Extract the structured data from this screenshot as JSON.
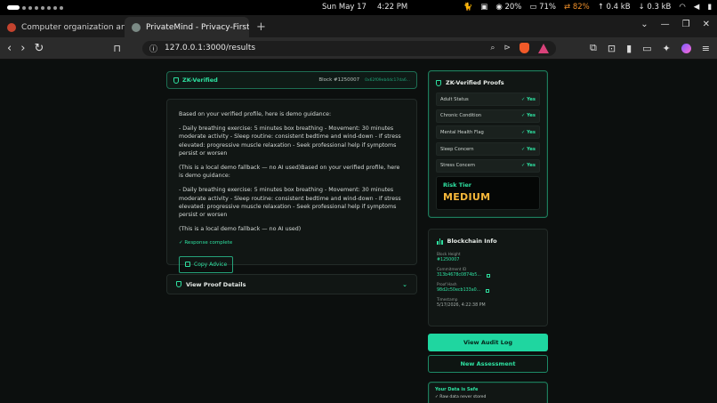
{
  "system_bar": {
    "date": "Sun May 17",
    "time": "4:22 PM",
    "cpu": "20%",
    "battery": "71%",
    "charge": "82%",
    "upload": "0.4 kB",
    "download": "0.3 kB"
  },
  "tabs": [
    {
      "title": "Computer organization and a",
      "active": false
    },
    {
      "title": "PrivateMind - Privacy-First",
      "active": true
    }
  ],
  "address_bar": {
    "url": "127.0.0.1:3000/results"
  },
  "zk_status": {
    "label": "ZK-Verified",
    "block": "Block #1250007",
    "hash": "0x62f09eb4dc17da6..."
  },
  "response": {
    "paragraphs": [
      "Based on your verified profile, here is demo guidance:",
      "- Daily breathing exercise: 5 minutes box breathing - Movement: 30 minutes moderate activity - Sleep routine: consistent bedtime and wind-down - If stress elevated: progressive muscle relaxation - Seek professional help if symptoms persist or worsen",
      "(This is a local demo fallback — no AI used)Based on your verified profile, here is demo guidance:",
      "- Daily breathing exercise: 5 minutes box breathing - Movement: 30 minutes moderate activity - Sleep routine: consistent bedtime and wind-down - If stress elevated: progressive muscle relaxation - Seek professional help if symptoms persist or worsen",
      "(This is a local demo fallback — no AI used)"
    ],
    "status": "Response complete",
    "copy_label": "Copy Advice"
  },
  "proof_details": {
    "label": "View Proof Details"
  },
  "zk_proofs": {
    "title": "ZK-Verified Proofs",
    "items": [
      {
        "label": "Adult Status",
        "value": "Yes"
      },
      {
        "label": "Chronic Condition",
        "value": "Yes"
      },
      {
        "label": "Mental Health Flag",
        "value": "Yes"
      },
      {
        "label": "Sleep Concern",
        "value": "Yes"
      },
      {
        "label": "Stress Concern",
        "value": "Yes"
      }
    ],
    "risk_label": "Risk Tier",
    "risk_value": "MEDIUM"
  },
  "blockchain": {
    "title": "Blockchain Info",
    "block_height_label": "Block Height",
    "block_height": "#1250007",
    "commitment_label": "Commitment ID",
    "commitment": "313b4678c0874b5...",
    "proof_hash_label": "Proof Hash",
    "proof_hash": "98d2c50ecb133a0...",
    "timestamp_label": "Timestamp",
    "timestamp": "5/17/2026, 4:22:38 PM"
  },
  "actions": {
    "audit": "View Audit Log",
    "new": "New Assessment"
  },
  "safety": {
    "title": "Your Data is Safe",
    "item1": "✓ Raw data never stored"
  },
  "colors": {
    "accent": "#2ee0a0",
    "warning": "#f6b83a",
    "background": "#0c0f0e"
  }
}
